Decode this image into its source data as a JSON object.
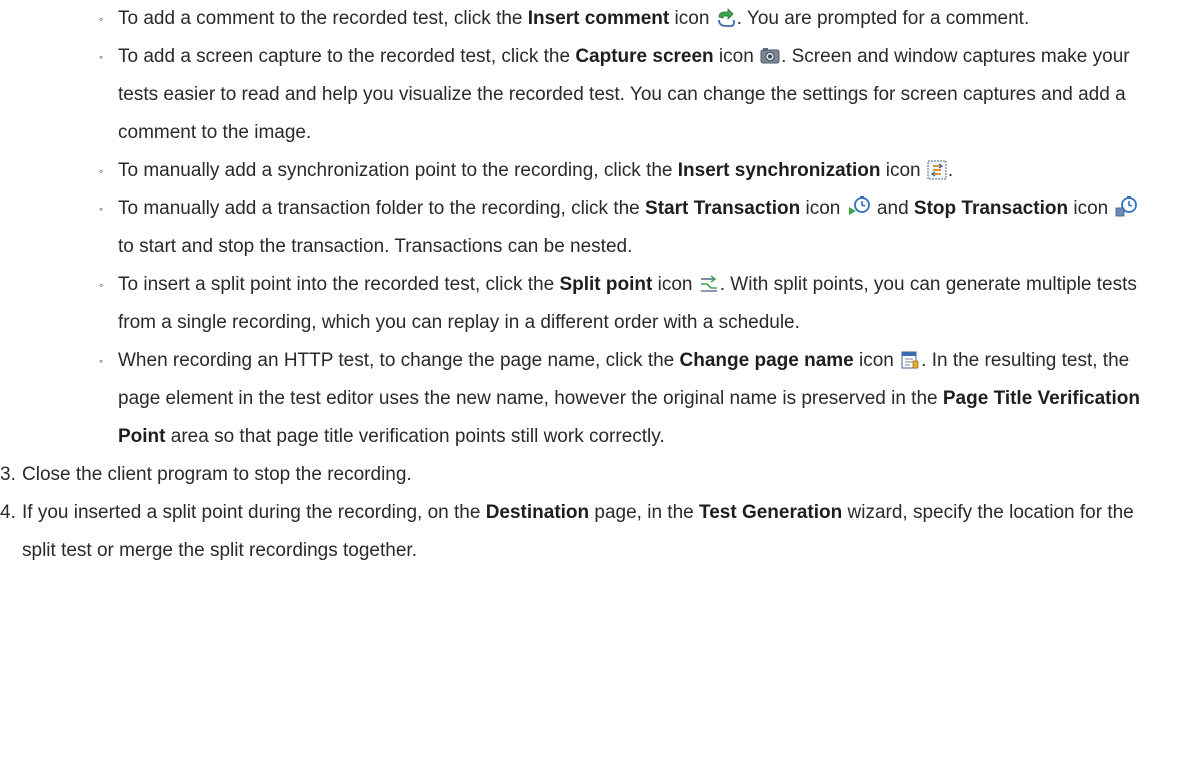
{
  "bullet_char": "◦",
  "sub_items": [
    {
      "t1": "To add a comment to the recorded test, click the ",
      "b1": "Insert comment",
      "t2": " icon ",
      "t3": ". You are prompted for a comment."
    },
    {
      "t1": "To add a screen capture to the recorded test, click the ",
      "b1": "Capture screen",
      "t2": " icon ",
      "t3": ". Screen and window captures make your tests easier to read and help you visualize the recorded test. You can change the settings for screen captures and add a comment to the image."
    },
    {
      "t1": "To manually add a synchronization point to the recording, click the ",
      "b1": "Insert synchronization",
      "t2": " icon ",
      "t3": "."
    },
    {
      "t1": "To manually add a transaction folder to the recording, click the ",
      "b1": "Start Transaction",
      "t2": " icon ",
      "t3": " and ",
      "b2": "Stop Transaction",
      "t4": " icon ",
      "t5": " to start and stop the transaction. Transactions can be nested."
    },
    {
      "t1": "To insert a split point into the recorded test, click the ",
      "b1": "Split point",
      "t2": " icon ",
      "t3": ". With split points, you can generate multiple tests from a single recording, which you can replay in a different order with a schedule."
    },
    {
      "t1": "When recording an HTTP test, to change the page name, click the ",
      "b1": "Change page name",
      "t2": " icon ",
      "t3": ". In the resulting test, the page element in the test editor uses the new name, however the original name is preserved in the ",
      "b2": "Page Title Verification Point",
      "t4": " area so that page title verification points still work correctly."
    }
  ],
  "steps": [
    {
      "num": "3.",
      "t1": "Close the client program to stop the recording."
    },
    {
      "num": "4.",
      "t1": "If you inserted a split point during the recording, on the ",
      "b1": "Destination",
      "t2": " page, in the ",
      "b2": "Test Generation",
      "t3": " wizard, specify the location for the split test or merge the split recordings together."
    }
  ]
}
